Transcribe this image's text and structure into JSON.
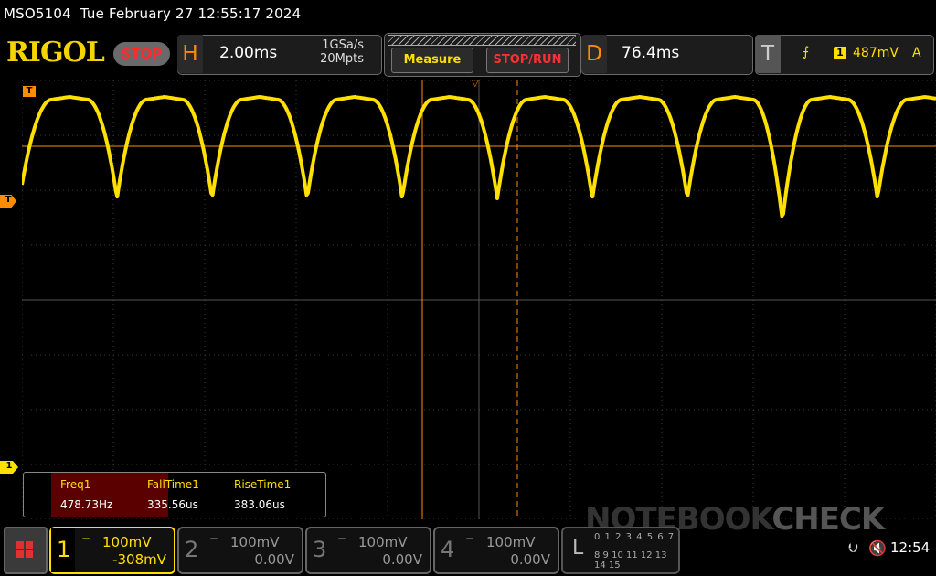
{
  "top": {
    "model": "MSO5104",
    "datetime": "Tue February 27 12:55:17 2024"
  },
  "header": {
    "brand": "RIGOL",
    "run_state": "STOP",
    "horizontal": {
      "letter": "H",
      "timebase": "2.00ms",
      "sample_rate": "1GSa/s",
      "memory_depth": "20Mpts"
    },
    "menu": {
      "measure_label": "Measure",
      "stoprun_label": "STOP/RUN"
    },
    "delay": {
      "letter": "D",
      "value": "76.4ms"
    },
    "trigger": {
      "letter": "T",
      "source": "1",
      "level": "487mV",
      "mode": "A",
      "edge_icon": "rising-edge-icon"
    }
  },
  "markers": {
    "trigger_time": "T",
    "trigger_level": "T",
    "ch1_offset": "1"
  },
  "measurements": [
    {
      "name": "Freq1",
      "value": "478.73Hz"
    },
    {
      "name": "FallTime1",
      "value": "335.56us"
    },
    {
      "name": "RiseTime1",
      "value": "383.06us"
    }
  ],
  "watermark": {
    "text1": "NOTEBOOK",
    "text2": "CHECK"
  },
  "channels": [
    {
      "num": "1",
      "coupling_icon": "dc-coupling-icon",
      "scale": "100mV",
      "offset": "-308mV",
      "active": true
    },
    {
      "num": "2",
      "coupling_icon": "dc-coupling-icon",
      "scale": "100mV",
      "offset": "0.00V",
      "active": false
    },
    {
      "num": "3",
      "coupling_icon": "dc-coupling-icon",
      "scale": "100mV",
      "offset": "0.00V",
      "active": false
    },
    {
      "num": "4",
      "coupling_icon": "dc-coupling-icon",
      "scale": "100mV",
      "offset": "0.00V",
      "active": false
    }
  ],
  "logic": {
    "letter": "L",
    "row1": "0 1 2 3 4 5 6 7",
    "row2": "8 9 10 11 12 13 14 15"
  },
  "status": {
    "clock": "12:54",
    "usb_icon": "usb-icon",
    "speaker_icon": "speaker-muted-icon"
  },
  "colors": {
    "ch1": "#ffe000",
    "trigger": "#ff8c00",
    "stop": "#ff2a2a",
    "grid": "#3a3a3a"
  },
  "waveform": {
    "units": "time divisions (x, 0-10) and voltage divisions (y, +4 top to -4 bottom)",
    "high_level_div": 3.65,
    "period_div": 1.04,
    "trough_levels_div": [
      2.1,
      1.85,
      1.85,
      1.85,
      1.85,
      1.85,
      1.85,
      1.85,
      1.45,
      1.85
    ]
  }
}
